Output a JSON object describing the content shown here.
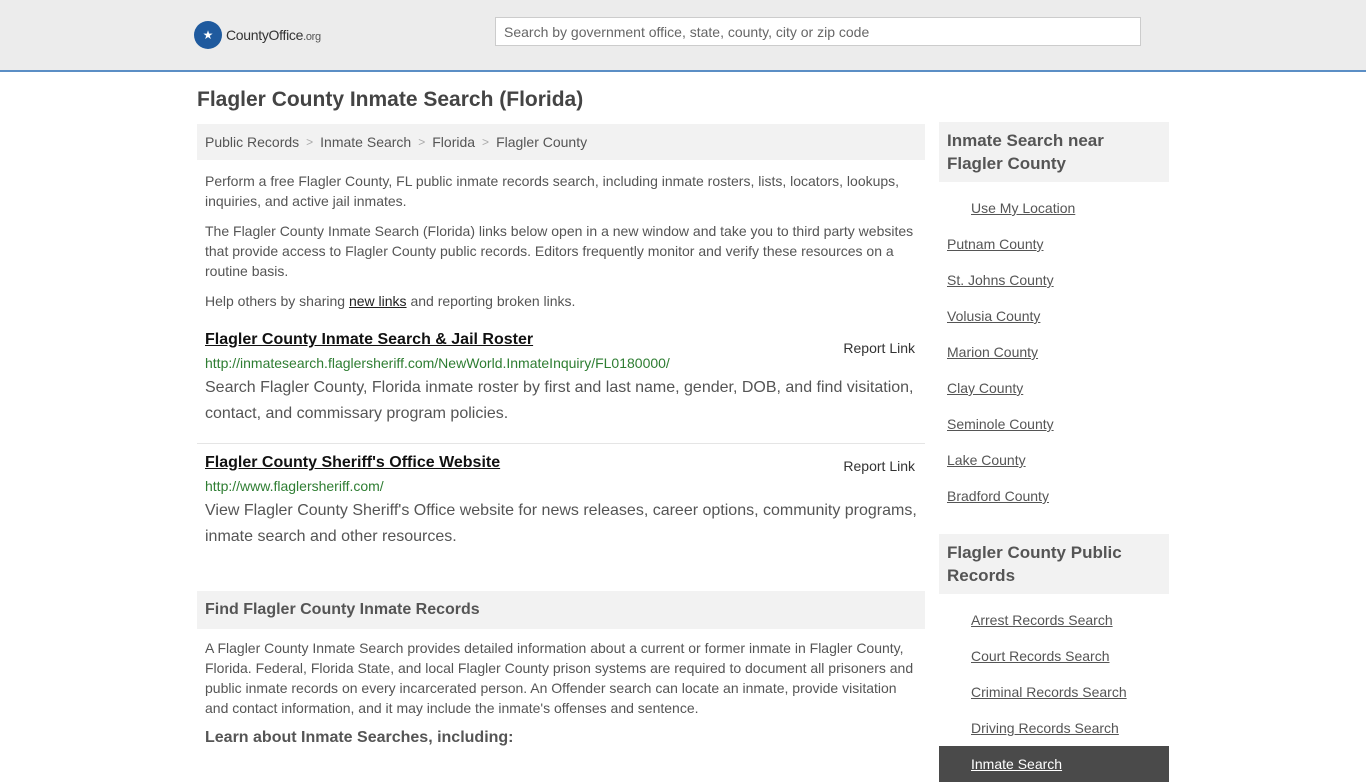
{
  "header": {
    "logo_main": "CountyOffice",
    "logo_suffix": ".org",
    "search_placeholder": "Search by government office, state, county, city or zip code"
  },
  "page_title": "Flagler County Inmate Search (Florida)",
  "breadcrumb": [
    "Public Records",
    "Inmate Search",
    "Florida",
    "Flagler County"
  ],
  "breadcrumb_sep": ">",
  "intro": {
    "p1": "Perform a free Flagler County, FL public inmate records search, including inmate rosters, lists, locators, lookups, inquiries, and active jail inmates.",
    "p2": "The Flagler County Inmate Search (Florida) links below open in a new window and take you to third party websites that provide access to Flagler County public records. Editors frequently monitor and verify these resources on a routine basis.",
    "p3_before": "Help others by sharing ",
    "p3_link": "new links",
    "p3_after": " and reporting broken links."
  },
  "results": [
    {
      "title": "Flagler County Inmate Search & Jail Roster",
      "report": "Report Link",
      "url": "http://inmatesearch.flaglersheriff.com/NewWorld.InmateInquiry/FL0180000/",
      "desc": "Search Flagler County, Florida inmate roster by first and last name, gender, DOB, and find visitation, contact, and commissary program policies."
    },
    {
      "title": "Flagler County Sheriff's Office Website",
      "report": "Report Link",
      "url": "http://www.flaglersheriff.com/",
      "desc": "View Flagler County Sheriff's Office website for news releases, career options, community programs, inmate search and other resources."
    }
  ],
  "find_section": {
    "heading": "Find Flagler County Inmate Records",
    "body": "A Flagler County Inmate Search provides detailed information about a current or former inmate in Flagler County, Florida. Federal, Florida State, and local Flagler County prison systems are required to document all prisoners and public inmate records on every incarcerated person. An Offender search can locate an inmate, provide visitation and contact information, and it may include the inmate's offenses and sentence.",
    "learn": "Learn about Inmate Searches, including:"
  },
  "sidebar": {
    "near_heading": "Inmate Search near Flagler County",
    "near_items": [
      "Use My Location",
      "Putnam County",
      "St. Johns County",
      "Volusia County",
      "Marion County",
      "Clay County",
      "Seminole County",
      "Lake County",
      "Bradford County"
    ],
    "records_heading": "Flagler County Public Records",
    "records_items": [
      "Arrest Records Search",
      "Court Records Search",
      "Criminal Records Search",
      "Driving Records Search",
      "Inmate Search"
    ]
  }
}
